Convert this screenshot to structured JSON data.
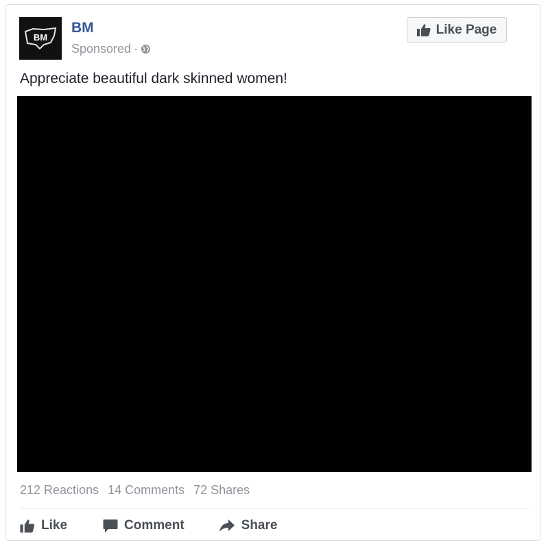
{
  "post": {
    "page_name": "BM",
    "avatar_text": "BM",
    "sponsored_label": "Sponsored",
    "meta_separator": "·",
    "like_page_label": "Like Page",
    "text": "Appreciate beautiful dark skinned women!",
    "stats": {
      "reactions": "212 Reactions",
      "comments": "14 Comments",
      "shares": "72 Shares"
    },
    "actions": {
      "like": "Like",
      "comment": "Comment",
      "share": "Share"
    }
  },
  "icons": {
    "avatar": "bm-logo-icon",
    "privacy": "globe-icon",
    "like_page": "thumbs-up-icon",
    "like": "thumbs-up-icon",
    "comment": "speech-bubble-icon",
    "share": "share-arrow-icon"
  },
  "colors": {
    "page_name": "#365899",
    "meta_text": "#90949c",
    "action_text": "#4b4f56",
    "media_background": "#000000"
  }
}
